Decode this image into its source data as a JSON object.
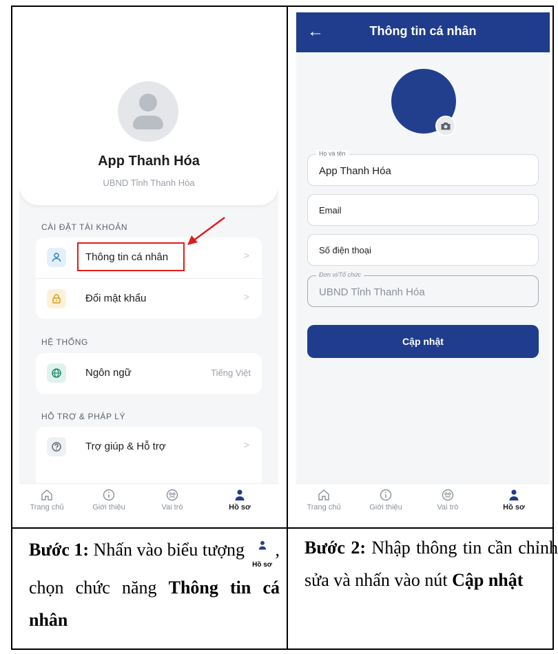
{
  "screen1": {
    "profile": {
      "name": "App Thanh Hóa",
      "org": "UBND Tỉnh Thanh Hóa"
    },
    "sections": [
      {
        "title": "CÀI ĐẶT TÀI KHOẢN",
        "items": [
          {
            "label": "Thông tin cá nhân",
            "icon": "user-icon",
            "color": "#2e7bbf",
            "bg": "#e3f0fa",
            "chevron": ">"
          },
          {
            "label": "Đổi mật khẩu",
            "icon": "lock-icon",
            "color": "#d99a19",
            "bg": "#fdf1da",
            "chevron": ">"
          }
        ]
      },
      {
        "title": "HỆ THỐNG",
        "items": [
          {
            "label": "Ngôn ngữ",
            "icon": "globe-icon",
            "color": "#1a8a6c",
            "bg": "#dff3ec",
            "value": "Tiếng Việt"
          }
        ]
      },
      {
        "title": "HỖ TRỢ & PHÁP LÝ",
        "items": [
          {
            "label": "Trợ giúp & Hỗ trợ",
            "icon": "help-icon",
            "color": "#5b616b",
            "bg": "#eef0f3",
            "chevron": ">"
          }
        ]
      }
    ]
  },
  "nav": [
    {
      "label": "Trang chủ",
      "icon": "home-icon"
    },
    {
      "label": "Giới thiệu",
      "icon": "info-icon"
    },
    {
      "label": "Vai trò",
      "icon": "role-icon"
    },
    {
      "label": "Hồ sơ",
      "icon": "profile-icon",
      "active": true
    }
  ],
  "screen2": {
    "title": "Thông tin cá nhân",
    "back": "←",
    "fields": {
      "name_label": "Họ và tên",
      "name_value": "App Thanh Hóa",
      "email_placeholder": "Email",
      "phone_placeholder": "Số điện thoại",
      "org_label": "Đơn vị/Tổ chức",
      "org_value": "UBND Tỉnh Thanh Hóa"
    },
    "update_label": "Cập nhật"
  },
  "captions": {
    "step1_bold": "Bước 1:",
    "step1_text": " Nhấn vào biểu tượng ",
    "step1_icon_label": "Hồ sơ",
    "step1_text2": ", chọn chức năng ",
    "step1_bold2": "Thông tin cá nhân",
    "step2_bold": "Bước 2:",
    "step2_text": " Nhập thông tin cần chỉnh sửa và nhấn vào nút ",
    "step2_bold2": "Cập nhật"
  },
  "colors": {
    "primary": "#1f3d8c",
    "highlight": "#e21b1b"
  }
}
